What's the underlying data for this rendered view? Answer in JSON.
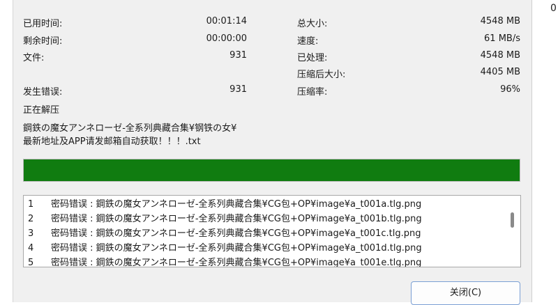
{
  "corner_text": "0",
  "stats_left": [
    {
      "label": "已用时间:",
      "value": "00:01:14"
    },
    {
      "label": "剩余时间:",
      "value": "00:00:00"
    },
    {
      "label": "文件:",
      "value": "931"
    },
    {
      "label": "发生错误:",
      "value": "931"
    }
  ],
  "stats_right": [
    {
      "label": "总大小:",
      "value": "4548 MB"
    },
    {
      "label": "速度:",
      "value": "61 MB/s"
    },
    {
      "label": "已处理:",
      "value": "4548 MB"
    },
    {
      "label": "压缩后大小:",
      "value": "4405 MB"
    },
    {
      "label": "压缩率:",
      "value": "96%"
    }
  ],
  "status": "正在解压",
  "current_file": [
    "鋼鉄の魔女アンネローゼ-全系列典藏合集¥钢铁の女¥",
    "最新地址及APP请发邮箱自动获取！！！.txt"
  ],
  "progress": {
    "fraction": 1.0,
    "color": "#107c10"
  },
  "log": [
    {
      "num": "1",
      "text": "密码错误 : 鋼鉄の魔女アンネローゼ-全系列典藏合集¥CG包+OP¥image¥a_t001a.tlg.png"
    },
    {
      "num": "2",
      "text": "密码错误 : 鋼鉄の魔女アンネローゼ-全系列典藏合集¥CG包+OP¥image¥a_t001b.tlg.png"
    },
    {
      "num": "3",
      "text": "密码错误 : 鋼鉄の魔女アンネローゼ-全系列典藏合集¥CG包+OP¥image¥a_t001c.tlg.png"
    },
    {
      "num": "4",
      "text": "密码错误 : 鋼鉄の魔女アンネローゼ-全系列典藏合集¥CG包+OP¥image¥a_t001d.tlg.png"
    },
    {
      "num": "5",
      "text": "密码错误 : 鋼鉄の魔女アンネローゼ-全系列典藏合集¥CG包+OP¥image¥a_t001e.tlg.png"
    }
  ],
  "close_label": "关闭(C)"
}
